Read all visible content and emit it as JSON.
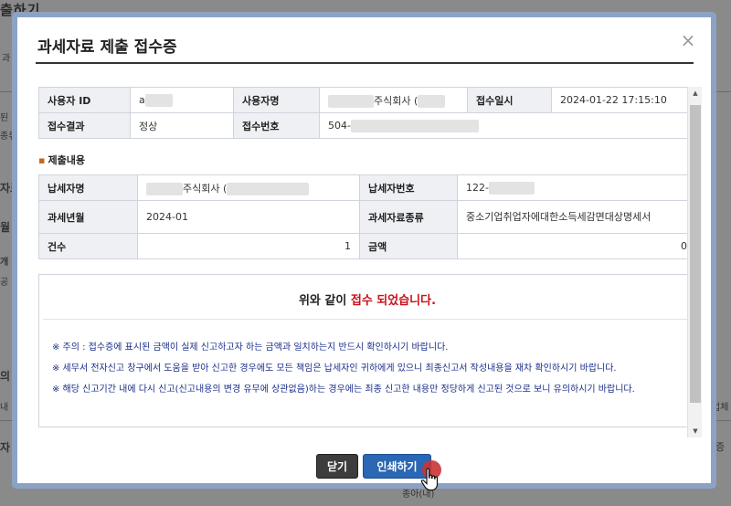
{
  "background": {
    "title": "출하기",
    "fragments": [
      "과",
      "된",
      "종류",
      "자료",
      "월",
      "개",
      "공",
      "의",
      "내",
      "자",
      "종아(내)",
      "업체",
      "증"
    ]
  },
  "modal": {
    "title": "과세자료 제출 접수증",
    "close_glyph": "×"
  },
  "receipt": {
    "user_id_label": "사용자 ID",
    "user_id_value": "a",
    "user_name_label": "사용자명",
    "user_name_value": "주식회사 (",
    "received_at_label": "접수일시",
    "received_at_value": "2024-01-22 17:15:10",
    "result_label": "접수결과",
    "result_value": "정상",
    "receipt_no_label": "접수번호",
    "receipt_no_value": "504-"
  },
  "submission": {
    "section_title": "제출내용",
    "taxpayer_name_label": "납세자명",
    "taxpayer_name_value": "주식회사 (",
    "taxpayer_no_label": "납세자번호",
    "taxpayer_no_value": "122-",
    "tax_period_label": "과세년월",
    "tax_period_value": "2024-01",
    "tax_type_label": "과세자료종류",
    "tax_type_value": "중소기업취업자에대한소득세감면대상명세서",
    "count_label": "건수",
    "count_value": "1",
    "amount_label": "금액",
    "amount_value": "0"
  },
  "result": {
    "msg_prefix": "위와 같이",
    "msg_highlight": "접수 되었습니다.",
    "notes": [
      "※ 주의 : 접수증에 표시된 금액이 실제 신고하고자 하는 금액과 일치하는지 반드시 확인하시기 바랍니다.",
      "※ 세무서 전자신고 창구에서 도움을 받아 신고한 경우에도 모든 책임은 납세자인 귀하에게 있으니 최종신고서 작성내용을 재차 확인하시기 바랍니다.",
      "※ 해당 신고기간 내에 다시 신고(신고내용의 변경 유무에 상관없음)하는 경우에는 최종 신고한 내용만 정당하게 신고된 것으로 보니 유의하시기 바랍니다."
    ]
  },
  "buttons": {
    "close_label": "닫기",
    "print_label": "인쇄하기"
  },
  "colors": {
    "accent_red": "#c8111a",
    "note_blue": "#1a2e8a",
    "print_button": "#2a67b4",
    "close_button": "#3d3d3d"
  },
  "icons": {
    "close": "close-icon",
    "cursor": "hand-pointer-icon"
  }
}
